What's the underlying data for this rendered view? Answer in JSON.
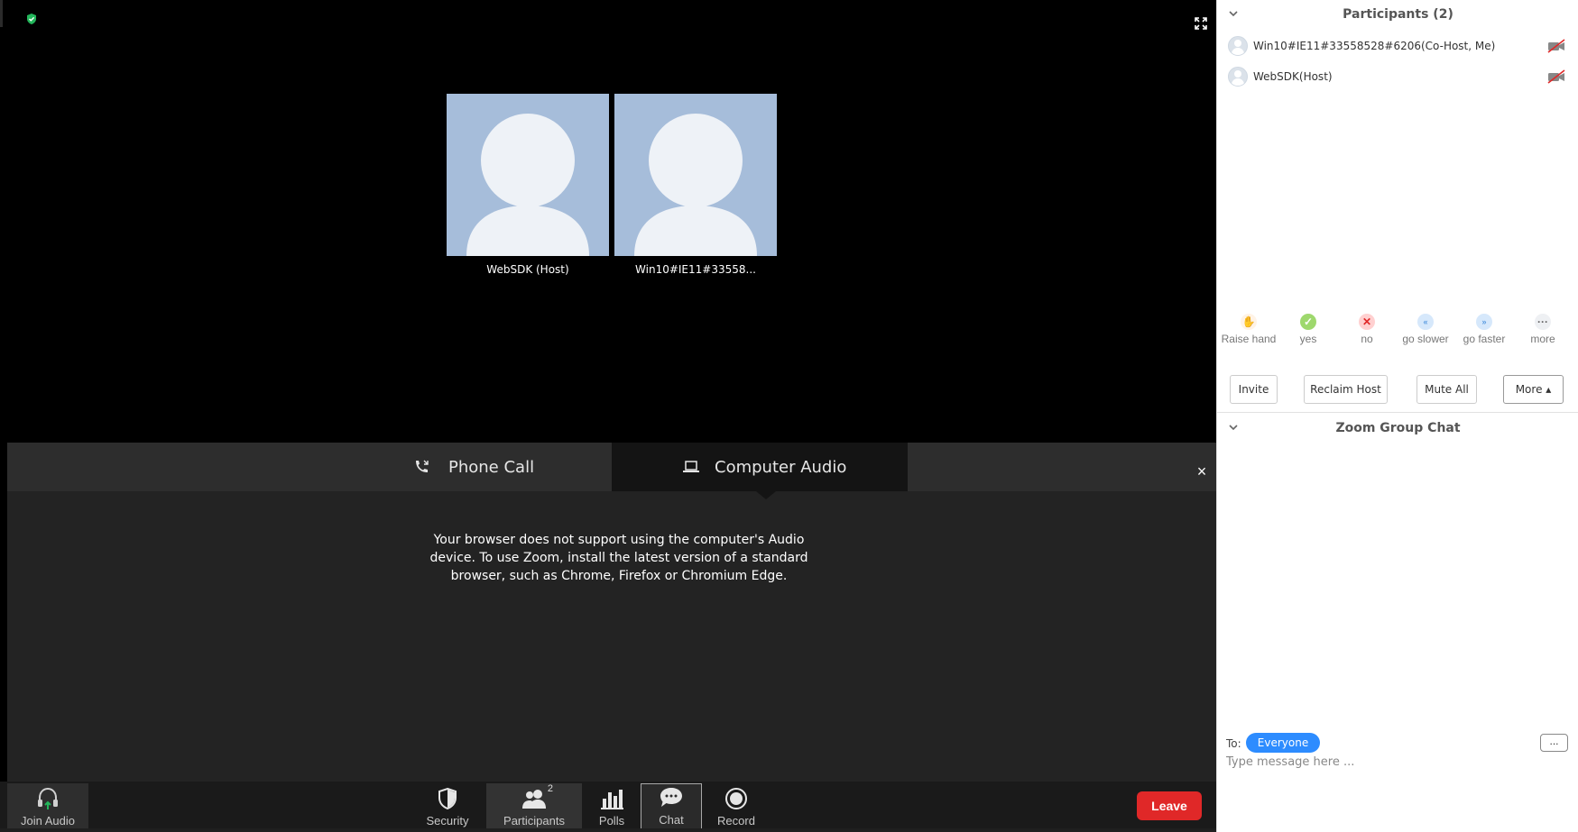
{
  "meeting": {
    "video_tiles": [
      {
        "name": "WebSDK (Host)"
      },
      {
        "name": "Win10#IE11#33558..."
      }
    ]
  },
  "audio": {
    "tabs": [
      {
        "label": "Phone Call",
        "icon": "phone-icon"
      },
      {
        "label": "Computer Audio",
        "icon": "laptop-icon"
      }
    ],
    "selected_tab": "Computer Audio",
    "message": "Your browser does not support using the computer's Audio device. To use Zoom, install the latest version of a standard browser, such as Chrome, Firefox or Chromium Edge.",
    "close_symbol": "×"
  },
  "toolbar": {
    "join_audio": "Join Audio",
    "security": "Security",
    "participants": "Participants",
    "participant_count": "2",
    "polls": "Polls",
    "chat": "Chat",
    "record": "Record",
    "leave": "Leave",
    "leave_color": "#e02828"
  },
  "participants_panel": {
    "title": "Participants (2)",
    "list": [
      {
        "name": "Win10#IE11#33558528#6206(Co-Host, Me)",
        "video": "video-off-icon"
      },
      {
        "name": "WebSDK(Host)",
        "video": "video-off-icon"
      }
    ],
    "reactions": [
      {
        "label": "Raise hand",
        "icon": "raise-hand-icon"
      },
      {
        "label": "yes",
        "icon": "check-icon"
      },
      {
        "label": "no",
        "icon": "x-icon"
      },
      {
        "label": "go slower",
        "icon": "go-slower-icon"
      },
      {
        "label": "go faster",
        "icon": "go-faster-icon"
      },
      {
        "label": "more",
        "icon": "more-dots-icon"
      }
    ],
    "buttons": {
      "invite": "Invite",
      "reclaim_host": "Reclaim Host",
      "mute_all": "Mute All",
      "more": "More ▴"
    }
  },
  "chat_panel": {
    "title": "Zoom Group Chat",
    "to_label": "To:",
    "recipient": "Everyone",
    "more_button": "...",
    "input_placeholder": "Type message here ..."
  },
  "colors": {
    "accent": "#2d8cff",
    "tile_bg": "#a6bdda"
  }
}
